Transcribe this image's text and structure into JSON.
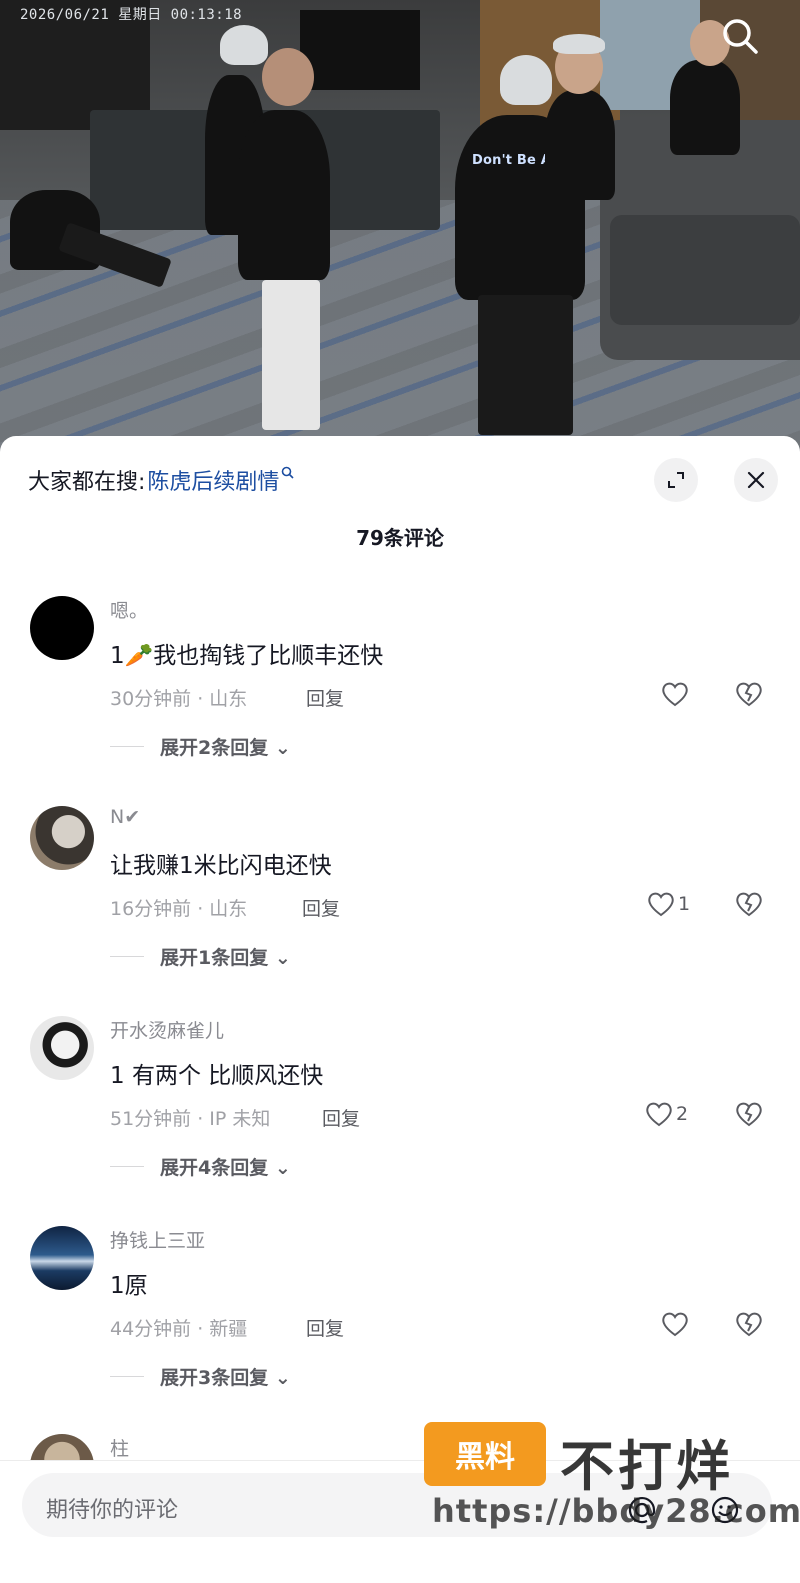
{
  "video": {
    "timestamp": "2026/06/21  星期日  00:13:18",
    "shirt_text": "Don't Be Afraid",
    "search_icon": "search-icon"
  },
  "sheet": {
    "hot_search_label": "大家都在搜:",
    "hot_search_keyword": "陈虎后续剧情",
    "hot_search_icon": "search-icon",
    "comment_count": "79条评论",
    "expand_icon": "expand-icon",
    "close_icon": "close-icon"
  },
  "comments": [
    {
      "nick": "嗯。",
      "text": "1🥕我也掏钱了比顺丰还快",
      "meta": "30分钟前 · 山东",
      "reply": "回复",
      "likes": "",
      "expand": "展开2条回复"
    },
    {
      "nick": "N✔",
      "text": "让我赚1米比闪电还快",
      "meta": "16分钟前 · 山东",
      "reply": "回复",
      "likes": "1",
      "expand": "展开1条回复"
    },
    {
      "nick": "开水烫麻雀儿",
      "text": "1 有两个 比顺风还快",
      "meta": "51分钟前 · IP 未知",
      "reply": "回复",
      "likes": "2",
      "expand": "展开4条回复"
    },
    {
      "nick": "挣钱上三亚",
      "text": "1原",
      "meta": "44分钟前 · 新疆",
      "reply": "回复",
      "likes": "",
      "expand": "展开3条回复"
    },
    {
      "nick": "柱",
      "text": "",
      "meta": "",
      "reply": "",
      "likes": "",
      "expand": ""
    }
  ],
  "composer": {
    "placeholder": "期待你的评论",
    "at_icon": "at-icon",
    "emoji_icon": "emoji-icon"
  },
  "watermark": {
    "badge": "黑料",
    "brand": "不打烊",
    "url": "https://bbdy28.com"
  },
  "colors": {
    "link": "#1d4ea1",
    "secondary_text": "#8a8b91",
    "watermark_orange": "#f39a1f"
  }
}
